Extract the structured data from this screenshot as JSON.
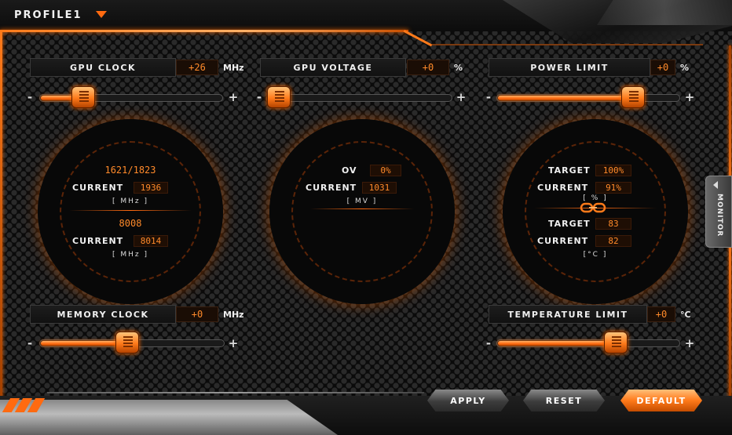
{
  "profile": {
    "label": "PROFILE1"
  },
  "gpu_clock": {
    "label": "GPU CLOCK",
    "value": "+26",
    "unit": "MHz",
    "slider_fraction": 0.2
  },
  "gpu_voltage": {
    "label": "GPU VOLTAGE",
    "value": "+0",
    "unit": "%",
    "slider_fraction": 0.0
  },
  "power_limit": {
    "label": "POWER LIMIT",
    "value": "+0",
    "unit": "%",
    "slider_fraction": 0.78
  },
  "memory_clock": {
    "label": "MEMORY CLOCK",
    "value": "+0",
    "unit": "MHz",
    "slider_fraction": 0.47
  },
  "temperature_limit": {
    "label": "TEMPERATURE LIMIT",
    "value": "+0",
    "unit": "°C",
    "slider_fraction": 0.67
  },
  "slider": {
    "minus": "-",
    "plus": "+"
  },
  "clock_ring": {
    "gpu_range": "1621/1823",
    "current_label": "CURRENT",
    "gpu_current": "1936",
    "gpu_unit": "[ MHz ]",
    "memory_value": "8008",
    "memory_current": "8014",
    "memory_unit": "[ MHz ]"
  },
  "voltage_ring": {
    "ov_label": "OV",
    "ov_value": "0%",
    "current_label": "CURRENT",
    "current_value": "1031",
    "unit": "[ MV ]"
  },
  "power_ring": {
    "target_label": "TARGET",
    "power_target": "100%",
    "current_label": "CURRENT",
    "power_current": "91%",
    "power_unit": "[ % ]",
    "temp_target": "83",
    "temp_current": "82",
    "temp_unit": "[°C ]"
  },
  "monitor_tab": {
    "label": "MONITOR"
  },
  "buttons": {
    "apply": "APPLY",
    "reset": "RESET",
    "default": "DEFAULT"
  },
  "colors": {
    "accent": "#ff7a1a",
    "value_text": "#ff8a2a",
    "background": "#0b0b0b"
  }
}
